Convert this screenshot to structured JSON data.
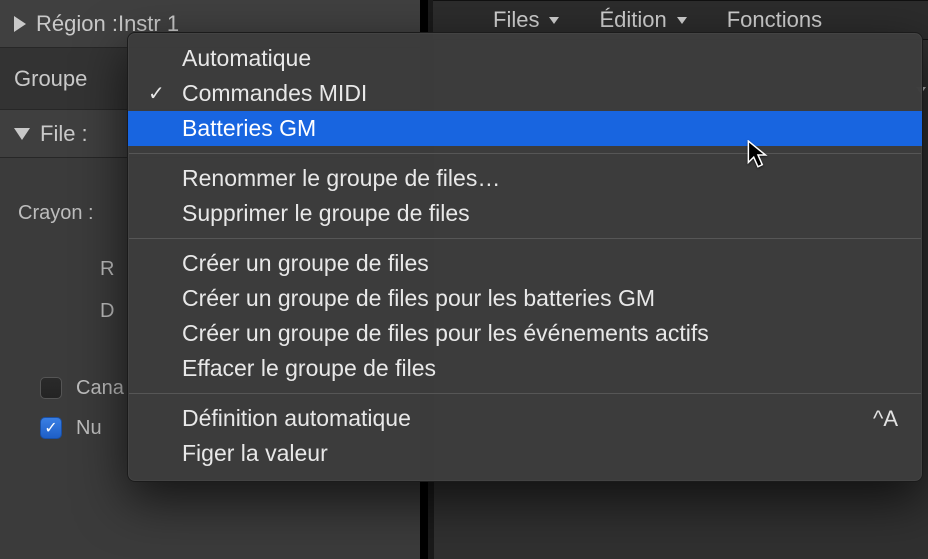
{
  "inspector": {
    "region_label_prefix": "Région : ",
    "region_name": "Instr 1",
    "group_label": "Groupe",
    "file_label": "File :",
    "crayon_label": "Crayon :",
    "param_r": "R",
    "param_d": "D",
    "check_cana": "Cana",
    "check_nu": "Nu",
    "nu_checked": true,
    "cana_checked": false
  },
  "tabs": {
    "files": "Files",
    "edit": "Édition",
    "functions": "Fonctions"
  },
  "menu": {
    "groups": [
      [
        {
          "label": "Automatique",
          "checked": false
        },
        {
          "label": "Commandes MIDI",
          "checked": true
        },
        {
          "label": "Batteries GM",
          "checked": false,
          "highlighted": true
        }
      ],
      [
        {
          "label": "Renommer le groupe de files…"
        },
        {
          "label": "Supprimer le groupe de files"
        }
      ],
      [
        {
          "label": "Créer un groupe de files"
        },
        {
          "label": "Créer un groupe de files pour les batteries GM"
        },
        {
          "label": "Créer un groupe de files pour les événements actifs"
        },
        {
          "label": "Effacer le groupe de files"
        }
      ],
      [
        {
          "label": "Définition automatique",
          "shortcut": "^A"
        },
        {
          "label": "Figer la valeur"
        }
      ]
    ]
  }
}
